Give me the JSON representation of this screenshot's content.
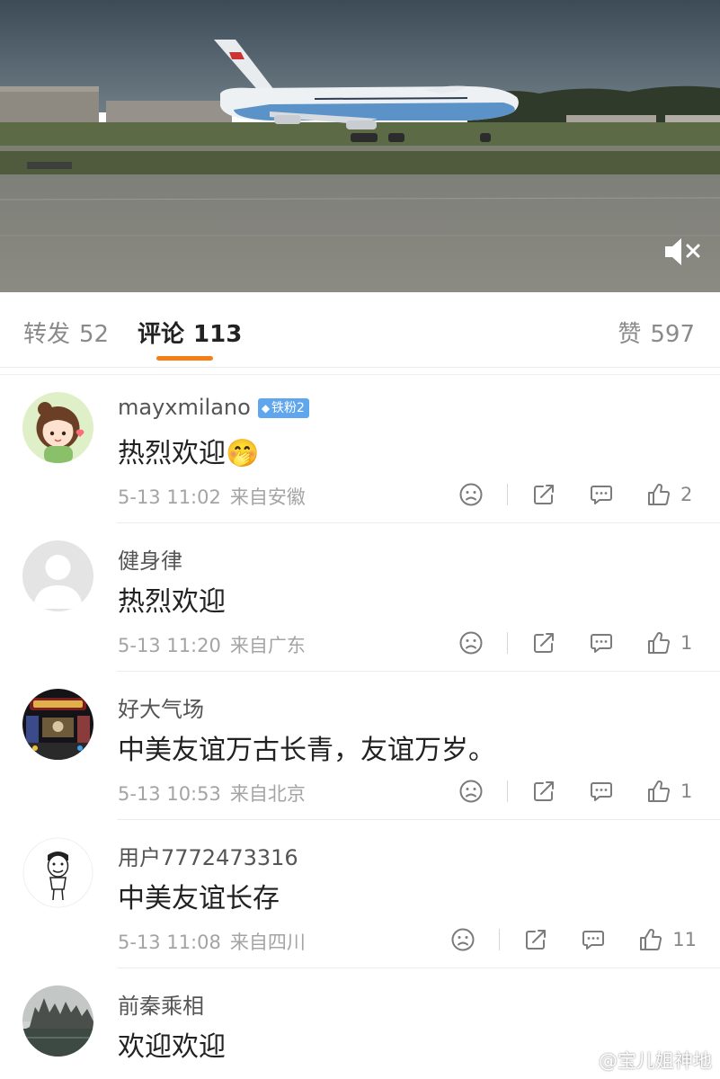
{
  "tabs": {
    "repost_label": "转发",
    "repost_count": "52",
    "comments_label": "评论",
    "comments_count": "113",
    "likes_label": "赞",
    "likes_count": "597"
  },
  "video": {
    "mute_icon": "speaker-muted-icon"
  },
  "comments": [
    {
      "username": "mayxmilano",
      "badge": "铁粉2",
      "badge_icon": "diamond-icon",
      "text": "热烈欢迎",
      "emoji": "🤭",
      "time": "5-13 11:02",
      "location": "来自安徽",
      "likes": "2"
    },
    {
      "username": "健身律",
      "text": "热烈欢迎",
      "time": "5-13 11:20",
      "location": "来自广东",
      "likes": "1"
    },
    {
      "username": "好大气场",
      "text": "中美友谊万古长青，友谊万岁。",
      "time": "5-13 10:53",
      "location": "来自北京",
      "likes": "1"
    },
    {
      "username": "用户7772473316",
      "text": "中美友谊长存",
      "time": "5-13 11:08",
      "location": "来自四川",
      "likes": "11"
    },
    {
      "username": "前秦乘相",
      "text": "欢迎欢迎"
    }
  ],
  "watermark": "@宝儿姐神地",
  "colors": {
    "accent": "#f57f17",
    "badge": "#5fa6ee",
    "muted_text": "#a4a4a4"
  }
}
